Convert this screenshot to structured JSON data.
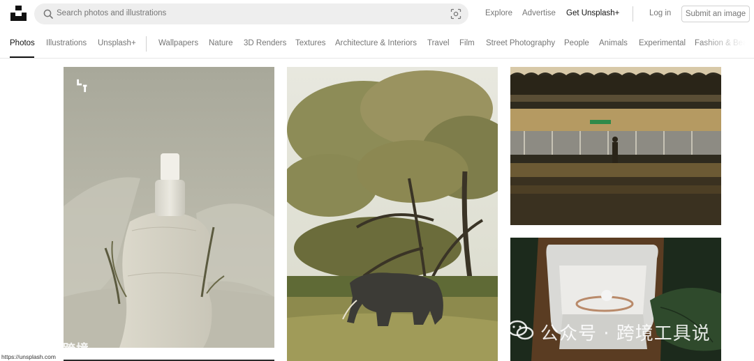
{
  "header": {
    "search_placeholder": "Search photos and illustrations",
    "links": {
      "explore": "Explore",
      "advertise": "Advertise",
      "get_plus": "Get Unsplash+",
      "login": "Log in"
    },
    "submit_label": "Submit an image"
  },
  "tabs": [
    "Photos",
    "Illustrations",
    "Unsplash+",
    "Wallpapers",
    "Nature",
    "3D Renders",
    "Textures",
    "Architecture & Interiors",
    "Travel",
    "Film",
    "Street Photography",
    "People",
    "Animals",
    "Experimental",
    "Fashion & Beauty"
  ],
  "active_tab": "Photos",
  "photos": [
    {
      "subject": "skincare dropper bottle on paper with dried leaves",
      "plus_badge": true
    },
    {
      "subject": "elephant under acacia tree in savanna"
    },
    {
      "subject": "man standing on a train station platform"
    },
    {
      "subject": "diamond ring in an open white ring box"
    }
  ],
  "status_url": "https://unsplash.com",
  "watermarks": {
    "left": "大数跨境",
    "right": "公众号 · 跨境工具说"
  },
  "colors": {
    "search_bg": "#eeeeee",
    "muted_text": "#767676",
    "dark_text": "#111111",
    "divider": "#d1d1d1"
  }
}
